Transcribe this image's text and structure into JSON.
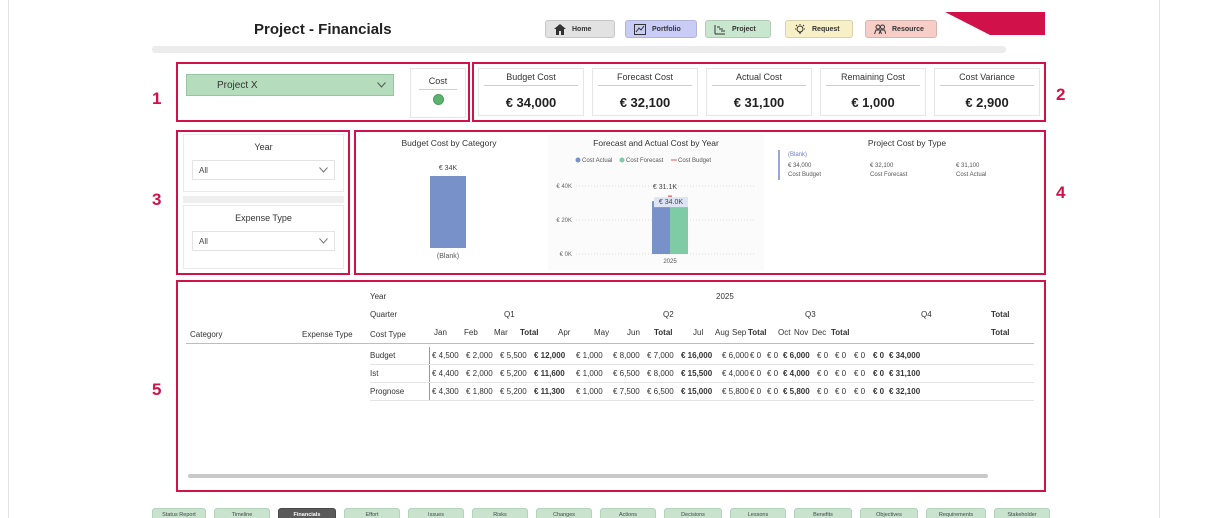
{
  "header": {
    "title": "Project - Financials",
    "nav": [
      {
        "label": "Home",
        "icon": "home-icon",
        "color": "#e2e2e2"
      },
      {
        "label": "Portfolio",
        "icon": "portfolio-icon",
        "color": "#c9cdf6"
      },
      {
        "label": "Project",
        "icon": "project-icon",
        "color": "#c9e6cf"
      },
      {
        "label": "Request",
        "icon": "lightbulb-icon",
        "color": "#f7efc6"
      },
      {
        "label": "Resource",
        "icon": "people-icon",
        "color": "#f6cdc7"
      }
    ]
  },
  "section_numbers": [
    "1",
    "2",
    "3",
    "4",
    "5"
  ],
  "accent_color": "#d1124a",
  "project_select": {
    "value": "Project X"
  },
  "cost_indicator": {
    "label": "Cost",
    "status_color": "#5cb36e"
  },
  "kpis": [
    {
      "label": "Budget Cost",
      "value": "€ 34,000"
    },
    {
      "label": "Forecast Cost",
      "value": "€ 32,100"
    },
    {
      "label": "Actual Cost",
      "value": "€ 31,100"
    },
    {
      "label": "Remaining Cost",
      "value": "€ 1,000"
    },
    {
      "label": "Cost Variance",
      "value": "€ 2,900"
    }
  ],
  "filters": {
    "year": {
      "label": "Year",
      "value": "All"
    },
    "expense_type": {
      "label": "Expense Type",
      "value": "All"
    }
  },
  "chart_data": [
    {
      "type": "bar",
      "title": "Budget Cost by Category",
      "categories": [
        "(Blank)"
      ],
      "values": [
        34000
      ],
      "data_labels": [
        "€ 34K"
      ],
      "color": "#7891c9"
    },
    {
      "type": "bar",
      "title": "Forecast and Actual Cost by Year",
      "categories": [
        "2025"
      ],
      "legend": [
        "Cost Actual",
        "Cost Forecast",
        "Cost Budget"
      ],
      "series": [
        {
          "name": "Cost Actual",
          "values": [
            31100
          ],
          "color": "#7891c9"
        },
        {
          "name": "Cost Forecast",
          "values": [
            32100
          ],
          "color": "#7ecba6"
        },
        {
          "name": "Cost Budget",
          "values": [
            34000
          ],
          "color": "#e57575"
        }
      ],
      "y_ticks": [
        "€ 40K",
        "€ 20K",
        "€ 0K"
      ],
      "ylim": [
        0,
        40000
      ],
      "data_labels": [
        "€ 31.1K",
        "€ 34.0K"
      ],
      "grid": true,
      "legend_position": "top"
    },
    {
      "type": "table",
      "title": "Project Cost by Type",
      "legend": [
        "(Blank)"
      ],
      "values": [
        "€ 34,000",
        "€ 32,100",
        "€ 31,100"
      ],
      "labels": [
        "Cost Budget",
        "Cost Forecast",
        "Cost Actual"
      ]
    }
  ],
  "matrix": {
    "row_headers": {
      "year": "Year",
      "quarter": "Quarter",
      "category": "Category",
      "expense_type": "Expense Type",
      "cost_type": "Cost Type"
    },
    "year": "2025",
    "quarters": [
      "Q1",
      "Q2",
      "Q3",
      "Q4"
    ],
    "total_label": "Total",
    "months": [
      "Jan",
      "Feb",
      "Mar",
      "Total",
      "Apr",
      "May",
      "Jun",
      "Total",
      "Jul",
      "Aug",
      "Sep",
      "Total",
      "Oct",
      "Nov",
      "Dec",
      "Total",
      "Total"
    ],
    "rows": [
      {
        "label": "Budget",
        "cells": [
          "€ 4,500",
          "€ 2,000",
          "€ 5,500",
          "€ 12,000",
          "€ 1,000",
          "€ 8,000",
          "€ 7,000",
          "€ 16,000",
          "€ 6,000",
          "€ 0",
          "€ 0",
          "€ 6,000",
          "€ 0",
          "€ 0",
          "€ 0",
          "€ 0",
          "€ 34,000"
        ]
      },
      {
        "label": "Ist",
        "cells": [
          "€ 4,400",
          "€ 2,000",
          "€ 5,200",
          "€ 11,600",
          "€ 1,000",
          "€ 6,500",
          "€ 8,000",
          "€ 15,500",
          "€ 4,000",
          "€ 0",
          "€ 0",
          "€ 4,000",
          "€ 0",
          "€ 0",
          "€ 0",
          "€ 0",
          "€ 31,100"
        ]
      },
      {
        "label": "Prognose",
        "cells": [
          "€ 4,300",
          "€ 1,800",
          "€ 5,200",
          "€ 11,300",
          "€ 1,000",
          "€ 7,500",
          "€ 6,500",
          "€ 15,000",
          "€ 5,800",
          "€ 0",
          "€ 0",
          "€ 5,800",
          "€ 0",
          "€ 0",
          "€ 0",
          "€ 0",
          "€ 32,100"
        ]
      }
    ]
  },
  "page_tabs": [
    "Status Report",
    "Timeline",
    "Financials",
    "Effort",
    "Issues",
    "Risks",
    "Changes",
    "Actions",
    "Decisions",
    "Lessons",
    "Benefits",
    "Objectives",
    "Requirements",
    "Stakeholder"
  ],
  "active_tab": "Financials"
}
